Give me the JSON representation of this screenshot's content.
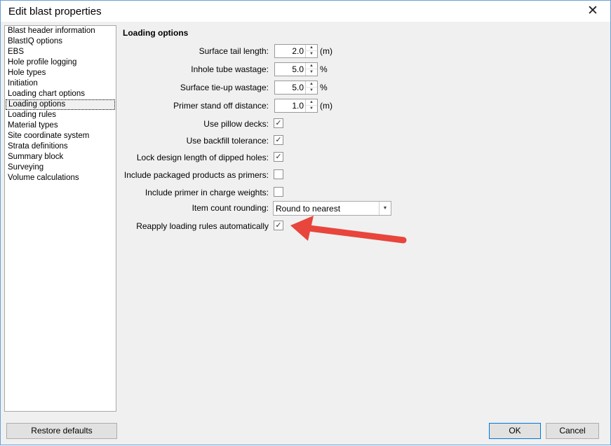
{
  "window": {
    "title": "Edit blast properties",
    "close_glyph": "✕"
  },
  "sidebar": {
    "items": [
      {
        "label": "Blast header information"
      },
      {
        "label": "BlastIQ options"
      },
      {
        "label": "EBS"
      },
      {
        "label": "Hole profile logging"
      },
      {
        "label": "Hole types"
      },
      {
        "label": "Initiation"
      },
      {
        "label": "Loading chart options"
      },
      {
        "label": "Loading options",
        "selected": true
      },
      {
        "label": "Loading rules"
      },
      {
        "label": "Material types"
      },
      {
        "label": "Site coordinate system"
      },
      {
        "label": "Strata definitions"
      },
      {
        "label": "Summary block"
      },
      {
        "label": "Surveying"
      },
      {
        "label": "Volume calculations"
      }
    ]
  },
  "panel": {
    "title": "Loading options",
    "surface_tail_length": {
      "label": "Surface tail length:",
      "value": "2.0",
      "unit": "(m)"
    },
    "inhole_tube_wastage": {
      "label": "Inhole tube wastage:",
      "value": "5.0",
      "unit": "%"
    },
    "surface_tieup_wastage": {
      "label": "Surface tie-up wastage:",
      "value": "5.0",
      "unit": "%"
    },
    "primer_standoff": {
      "label": "Primer stand off distance:",
      "value": "1.0",
      "unit": "(m)"
    },
    "use_pillow_decks": {
      "label": "Use pillow decks:",
      "checked": true
    },
    "use_backfill_tolerance": {
      "label": "Use backfill tolerance:",
      "checked": true
    },
    "lock_design_length": {
      "label": "Lock design length of dipped holes:",
      "checked": true
    },
    "include_packaged_primers": {
      "label": "Include packaged products as primers:",
      "checked": false
    },
    "include_primer_weights": {
      "label": "Include primer in charge weights:",
      "checked": false
    },
    "item_count_rounding": {
      "label": "Item count rounding:",
      "value": "Round to nearest"
    },
    "reapply_rules": {
      "label": "Reapply loading rules automatically",
      "checked": true
    }
  },
  "footer": {
    "restore_label": "Restore defaults",
    "ok_label": "OK",
    "cancel_label": "Cancel"
  },
  "icons": {
    "spin_up": "▲",
    "spin_down": "▼",
    "dropdown": "▼",
    "check": "✓"
  },
  "colors": {
    "annotation_arrow": "#e8453c",
    "selection_border": "#000000"
  }
}
